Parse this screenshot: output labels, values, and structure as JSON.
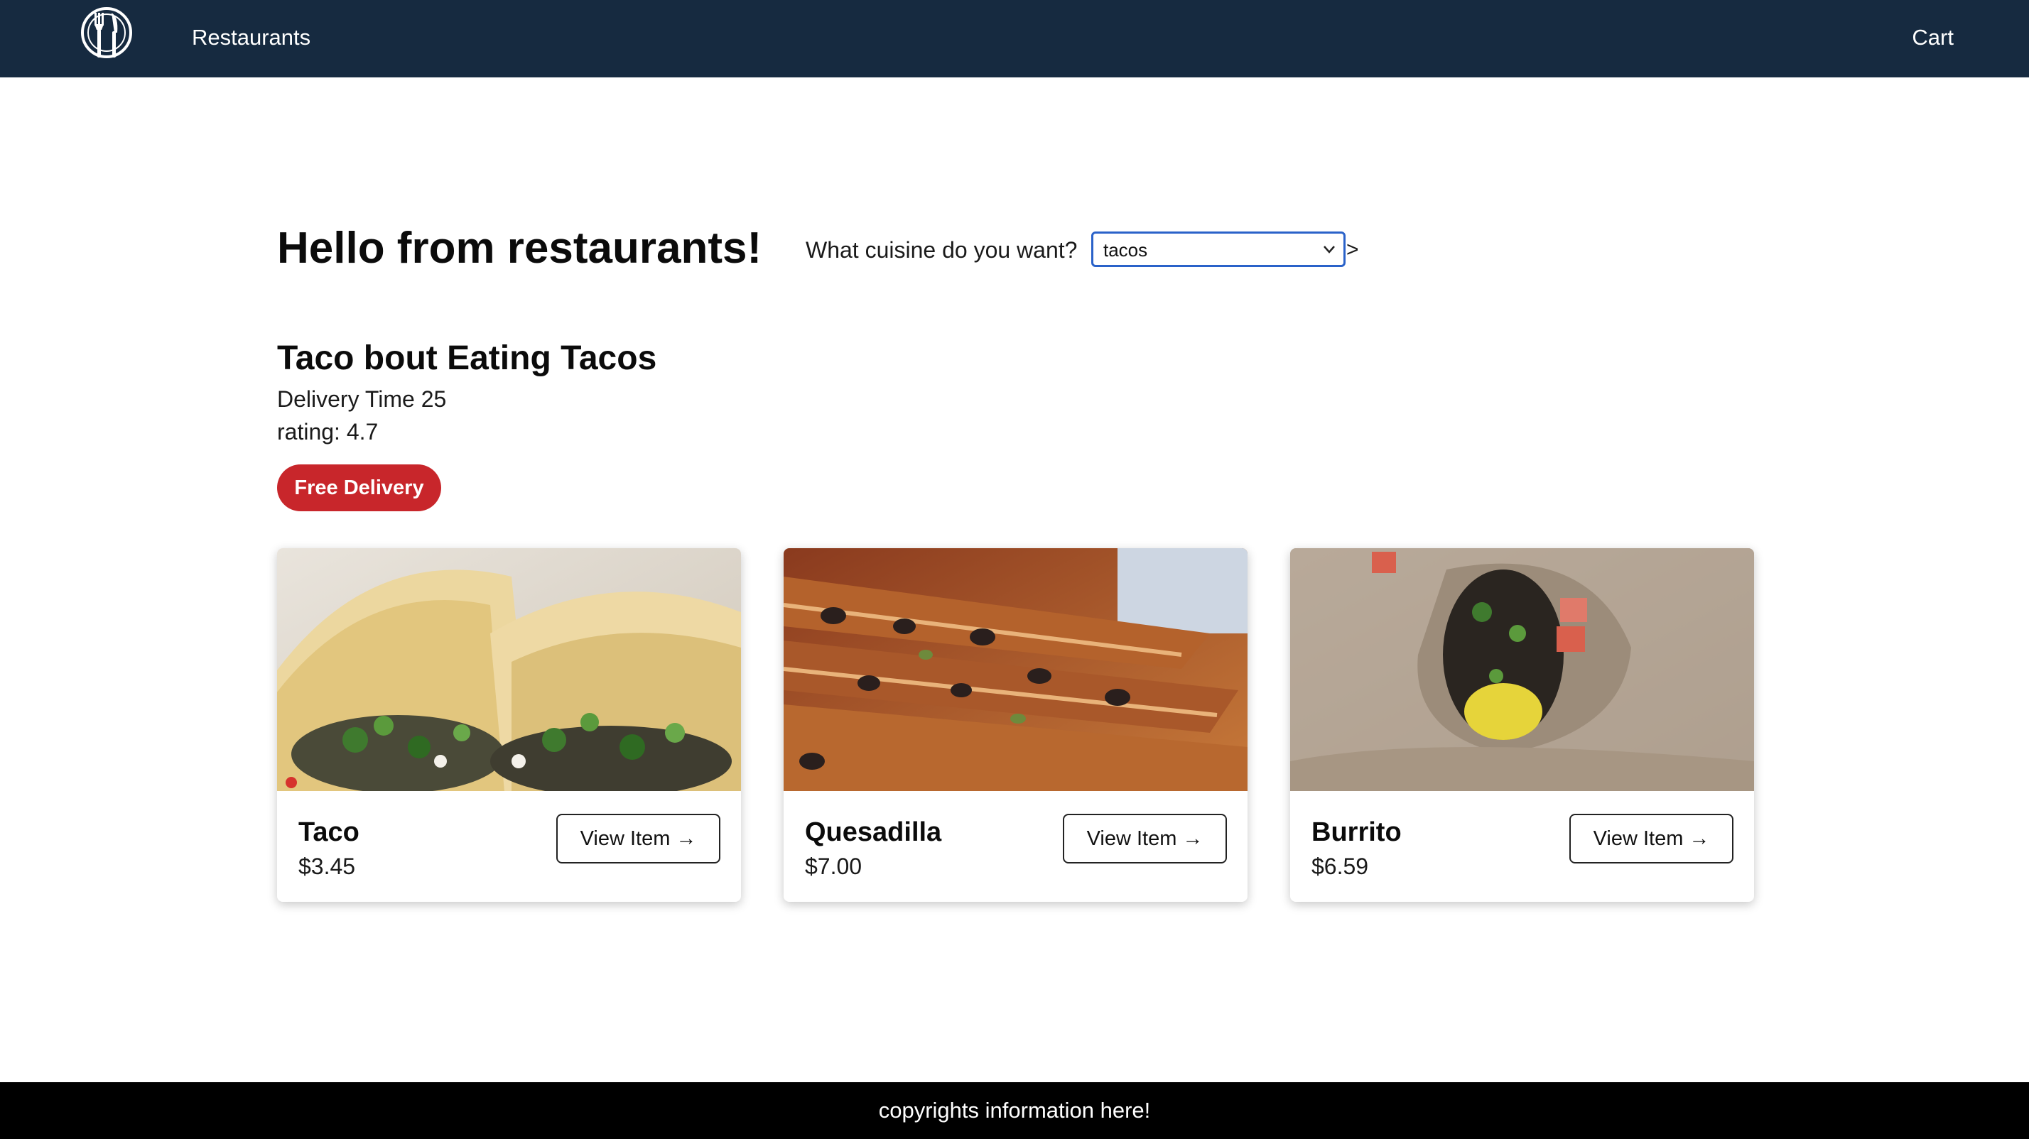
{
  "nav": {
    "logo_icon": "utensils-plate-icon",
    "restaurants_link": "Restaurants",
    "cart_link": "Cart",
    "bg_color": "#162a40"
  },
  "main": {
    "heading": "Hello from restaurants!",
    "cuisine_prompt": "What cuisine do you want?",
    "cuisine_selected": "tacos",
    "stray_char": ">"
  },
  "restaurant": {
    "name": "Taco bout Eating Tacos",
    "delivery_time": "Delivery Time 25",
    "rating": "rating: 4.7",
    "badge": "Free Delivery",
    "badge_color": "#c8262b"
  },
  "menu": {
    "items": [
      {
        "name": "Taco",
        "price": "$3.45",
        "button": "View Item →",
        "image": "taco-photo"
      },
      {
        "name": "Quesadilla",
        "price": "$7.00",
        "button": "View Item →",
        "image": "quesadilla-photo"
      },
      {
        "name": "Burrito",
        "price": "$6.59",
        "button": "View Item →",
        "image": "burrito-photo"
      }
    ]
  },
  "footer": {
    "text": "copyrights information here!"
  }
}
